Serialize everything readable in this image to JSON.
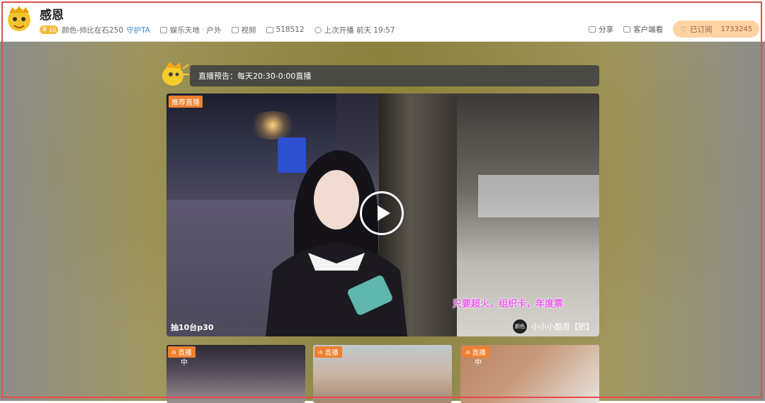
{
  "header": {
    "title": "感恩",
    "level_badge": "10",
    "author": "颜色-帅比在石250",
    "guard_label": "守护TA",
    "category": "娱乐天地",
    "subcategory": "户外",
    "video_label": "视频",
    "room_id": "518512",
    "last_live": "上次开播 前天 19:57",
    "share_label": "分享",
    "client_label": "客户端看",
    "subscribe_label": "已订阅",
    "subscribe_count": "1733245"
  },
  "notice": {
    "text": "直播预告：每天20:30-0:00直播"
  },
  "player": {
    "recommend_tag": "推荐直播",
    "subtitle": "只要超火，组织卡，年度票",
    "caption": "抽10台p30",
    "streamer_logo": "颜色",
    "streamer_name": "小小小酷哥【肥】"
  },
  "thumbs": [
    {
      "tag": "直播",
      "char": "中"
    },
    {
      "tag": "直播",
      "char": ""
    },
    {
      "tag": "直播",
      "char": "中"
    }
  ],
  "colors": {
    "accent": "#f07f2e",
    "subscribe_bg": "#ffd3a4",
    "guard": "#3a8fd8",
    "frame": "#e74c4c"
  }
}
